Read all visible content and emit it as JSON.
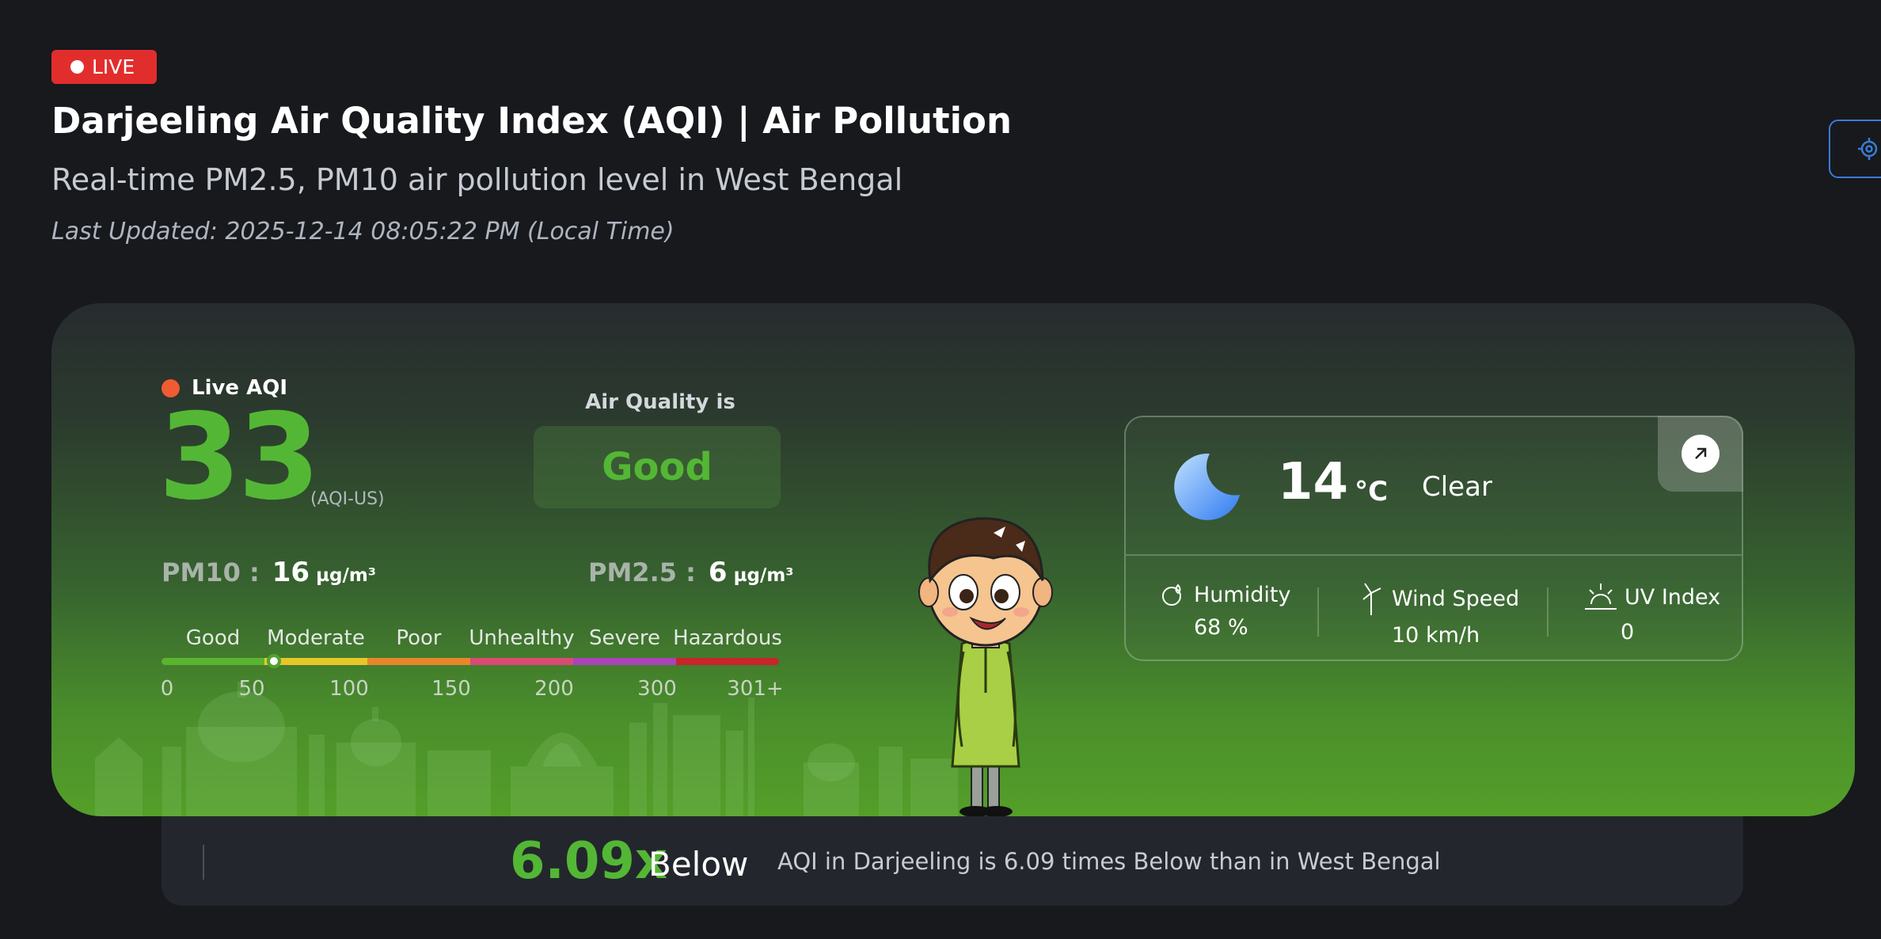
{
  "header": {
    "live_label": "LIVE",
    "title": "Darjeeling Air Quality Index (AQI) | Air Pollution",
    "subtitle": "Real-time PM2.5, PM10 air pollution level in West Bengal",
    "last_updated": "Last Updated: 2025-12-14 08:05:22 PM (Local Time)"
  },
  "aqi": {
    "live_label": "Live AQI",
    "value": "33",
    "unit": "(AQI-US)",
    "status_heading": "Air Quality is",
    "status": "Good",
    "status_color": "#53b735",
    "pm10": {
      "label": "PM10 :",
      "value": "16",
      "unit": "µg/m³"
    },
    "pm25": {
      "label": "PM2.5 :",
      "value": "6",
      "unit": "µg/m³"
    }
  },
  "scale": {
    "labels": [
      "Good",
      "Moderate",
      "Poor",
      "Unhealthy",
      "Severe",
      "Hazardous"
    ],
    "ticks": [
      "0",
      "50",
      "100",
      "150",
      "200",
      "300",
      "301+"
    ],
    "colors": [
      "#59b52f",
      "#e8c72a",
      "#e8872a",
      "#d94b74",
      "#a844b8",
      "#c8242a"
    ],
    "indicator_value": 33
  },
  "weather": {
    "icon": "crescent-moon-icon",
    "temperature": "14",
    "temperature_unit": "°C",
    "condition": "Clear",
    "humidity": {
      "label": "Humidity",
      "value": "68 %",
      "icon": "humidity-icon"
    },
    "wind": {
      "label": "Wind Speed",
      "value": "10 km/h",
      "icon": "wind-icon"
    },
    "uv": {
      "label": "UV Index",
      "value": "0",
      "icon": "uv-index-icon"
    }
  },
  "comparison": {
    "ratio": "6.09x",
    "direction": "Below",
    "text": "AQI in Darjeeling is 6.09 times Below than in West Bengal"
  }
}
